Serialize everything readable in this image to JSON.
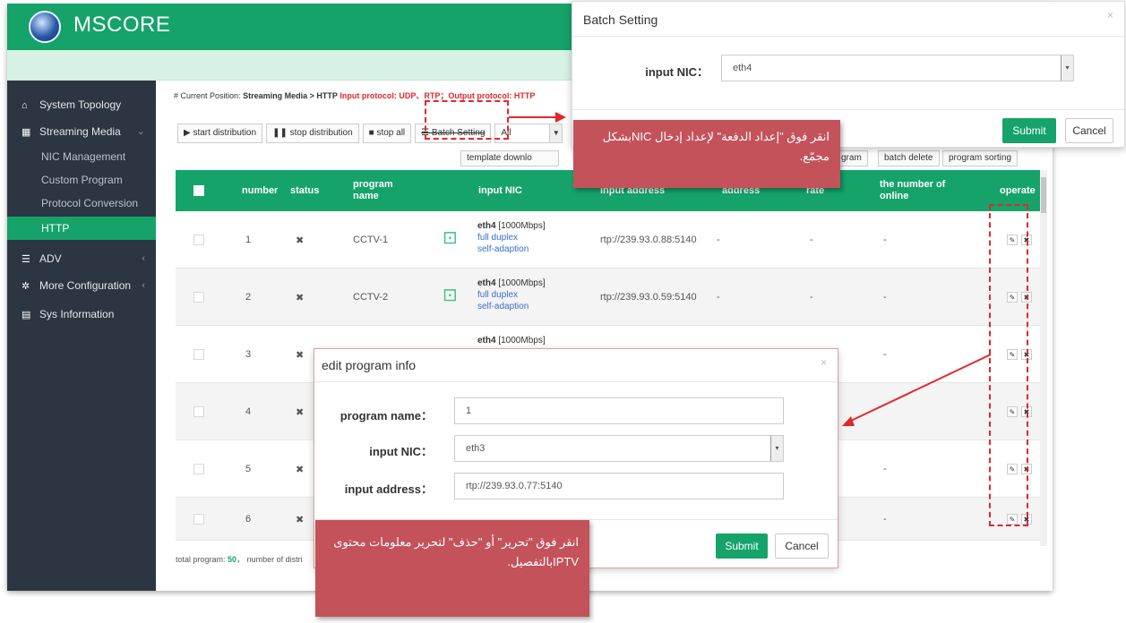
{
  "app": {
    "title": "MSCORE"
  },
  "sidebar": {
    "items": [
      {
        "label": "System Topology",
        "icon": "home-icon"
      },
      {
        "label": "Streaming Media",
        "icon": "film-icon"
      },
      {
        "label": "NIC Management"
      },
      {
        "label": "Custom Program"
      },
      {
        "label": "Protocol Conversion"
      },
      {
        "label": "HTTP"
      },
      {
        "label": "ADV",
        "icon": "list-icon"
      },
      {
        "label": "More Configuration",
        "icon": "gears-icon"
      },
      {
        "label": "Sys Information",
        "icon": "info-icon"
      }
    ]
  },
  "breadcrumb": {
    "prefix": "# Current Position:",
    "path": "Streaming Media > HTTP",
    "protocol": "Input protocol: UDP、RTP；Output protocol: HTTP"
  },
  "toolbar": {
    "start": "▶ start distribution",
    "stop": "❚❚ stop distribution",
    "stop_all": "■ stop all",
    "batch": "☰ Batch Setting",
    "filter": "All",
    "template": "template downlo",
    "program": "gram",
    "batch_delete": "batch delete",
    "program_sorting": "program sorting"
  },
  "table": {
    "headers": {
      "number": "number",
      "status": "status",
      "program": "program name",
      "nic": "input NIC",
      "address": "input address",
      "address2": "address",
      "rate": "rate",
      "online": "the number of online",
      "operate": "operate"
    },
    "rows": [
      {
        "number": "1",
        "status": "✖",
        "name": "CCTV-1",
        "nic": "eth4",
        "speed": "[1000Mbps]",
        "duplex": "full duplex",
        "mode": "self-adaption",
        "address": "rtp://239.93.0.88:5140",
        "dash": "-"
      },
      {
        "number": "2",
        "status": "✖",
        "name": "CCTV-2",
        "nic": "eth4",
        "speed": "[1000Mbps]",
        "duplex": "full duplex",
        "mode": "self-adaption",
        "address": "rtp://239.93.0.59:5140",
        "dash": "-"
      },
      {
        "number": "3",
        "status": "✖",
        "nic": "eth4",
        "speed": "[1000Mbps]",
        "dash": "-"
      },
      {
        "number": "4",
        "status": "✖",
        "dash": "-"
      },
      {
        "number": "5",
        "status": "✖",
        "dash": "-"
      },
      {
        "number": "6",
        "status": "✖",
        "dash": "-"
      }
    ]
  },
  "footer": {
    "label": "total program:",
    "count": "50",
    "rest": "， number of distri"
  },
  "batch_modal": {
    "title": "Batch Setting",
    "nic_label": "input NIC：",
    "nic_value": "eth4",
    "submit": "Submit",
    "cancel": "Cancel"
  },
  "edit_modal": {
    "title": "edit program info",
    "name_label": "program name：",
    "name_value": "1",
    "nic_label": "input NIC：",
    "nic_value": "eth3",
    "address_label": "input address：",
    "address_value": "rtp://239.93.0.77:5140",
    "submit": "Submit",
    "cancel": "Cancel"
  },
  "callouts": {
    "batch": "انقر فوق \"إعداد الدفعة\" لإعداد إدخال NICبشكل مجمّع.",
    "edit": "انقر فوق \"تحرير\" أو \"حذف\" لتحرير معلومات محتوى IPTVبالتفصيل."
  },
  "colors": {
    "accent": "#15a36a",
    "sidebar": "#2c3542",
    "callout": "#c4525a",
    "highlight": "#e2262d"
  }
}
